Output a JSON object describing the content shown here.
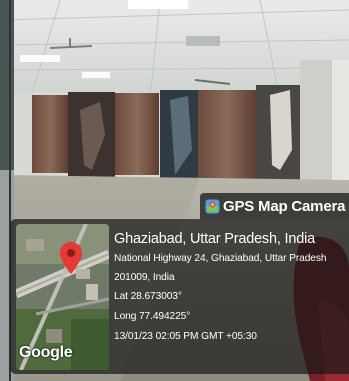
{
  "photo": {
    "description_icon": "indoor-hall-photo"
  },
  "badge": {
    "icon": "gps-camera-icon",
    "text": "GPS Map Camera"
  },
  "location": {
    "title": "Ghaziabad, Uttar Pradesh, India",
    "address_line1": "National Highway 24, Ghaziabad, Uttar Pradesh",
    "address_line2": "201009, India",
    "lat": "Lat 28.673003°",
    "long": "Long 77.494225°",
    "timestamp": "13/01/23 02:05 PM GMT +05:30"
  },
  "map": {
    "brand": "Google",
    "pin_color": "#e53935"
  }
}
